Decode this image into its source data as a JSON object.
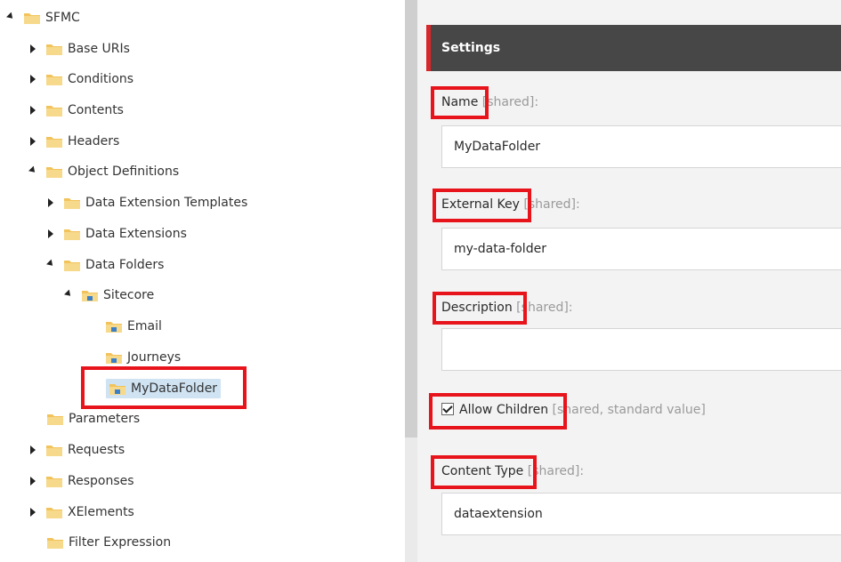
{
  "tree": {
    "root": {
      "label": "SFMC"
    },
    "items": {
      "base_uris": {
        "label": "Base URIs"
      },
      "conditions": {
        "label": "Conditions"
      },
      "contents": {
        "label": "Contents"
      },
      "headers": {
        "label": "Headers"
      },
      "object_definitions": {
        "label": "Object Definitions"
      },
      "data_extension_templates": {
        "label": "Data Extension Templates"
      },
      "data_extensions": {
        "label": "Data Extensions"
      },
      "data_folders": {
        "label": "Data Folders"
      },
      "sitecore": {
        "label": "Sitecore"
      },
      "email": {
        "label": "Email"
      },
      "journeys": {
        "label": "Journeys"
      },
      "mydatafolder": {
        "label": "MyDataFolder"
      },
      "parameters": {
        "label": "Parameters"
      },
      "requests": {
        "label": "Requests"
      },
      "responses": {
        "label": "Responses"
      },
      "xelements": {
        "label": "XElements"
      },
      "filter_expression": {
        "label": "Filter Expression"
      }
    }
  },
  "settings": {
    "title": "Settings",
    "fields": {
      "name": {
        "label": "Name",
        "meta": " [shared]:",
        "value": "MyDataFolder"
      },
      "external_key": {
        "label": "External Key",
        "meta": " [shared]:",
        "value": "my-data-folder"
      },
      "description": {
        "label": "Description",
        "meta": " [shared]:",
        "value": ""
      },
      "allow_children": {
        "label": "Allow Children",
        "meta": " [shared, standard value]",
        "checked": true
      },
      "content_type": {
        "label": "Content Type",
        "meta": " [shared]:",
        "value": "dataextension"
      }
    }
  },
  "colors": {
    "highlight": "#e8141c",
    "header_bg": "#474747",
    "header_accent": "#d8262a",
    "selection": "#cfe3f3"
  }
}
